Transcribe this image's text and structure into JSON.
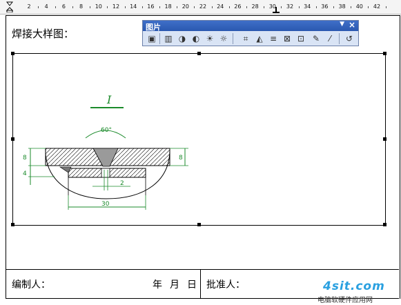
{
  "ruler": {
    "labels": [
      "2",
      "4",
      "6",
      "8",
      "10",
      "12",
      "14",
      "16",
      "18",
      "20",
      "22",
      "24",
      "26",
      "28",
      "30",
      "32",
      "34",
      "36",
      "38",
      "40",
      "42"
    ]
  },
  "document": {
    "title": "焊接大样图：",
    "compiled_by_label": "编制人：",
    "date_year": "年",
    "date_month": "月",
    "date_day": "日",
    "approved_by_label": "批准人："
  },
  "toolbar": {
    "title": "图片",
    "buttons": [
      "insert-picture-icon",
      "color-icon",
      "more-contrast-icon",
      "less-contrast-icon",
      "more-brightness-icon",
      "less-brightness-icon",
      "crop-icon",
      "rotate-left-icon",
      "line-style-icon",
      "compress-picture-icon",
      "text-wrapping-icon",
      "format-picture-icon",
      "set-transparent-color-icon",
      "reset-picture-icon"
    ]
  },
  "drawing": {
    "section_label": "I",
    "angle_label": "60°",
    "dim_left_top": "8",
    "dim_left_bottom": "4",
    "dim_right": "8",
    "gap_label": "2",
    "width_label": "30"
  },
  "watermark": {
    "logo": "4sit.com",
    "subtitle": "电脑软硬件应用网"
  },
  "colors": {
    "dimension_green": "#1a8a2a",
    "titlebar_blue": "#2a58b0",
    "watermark_blue": "#2aa0e0"
  }
}
